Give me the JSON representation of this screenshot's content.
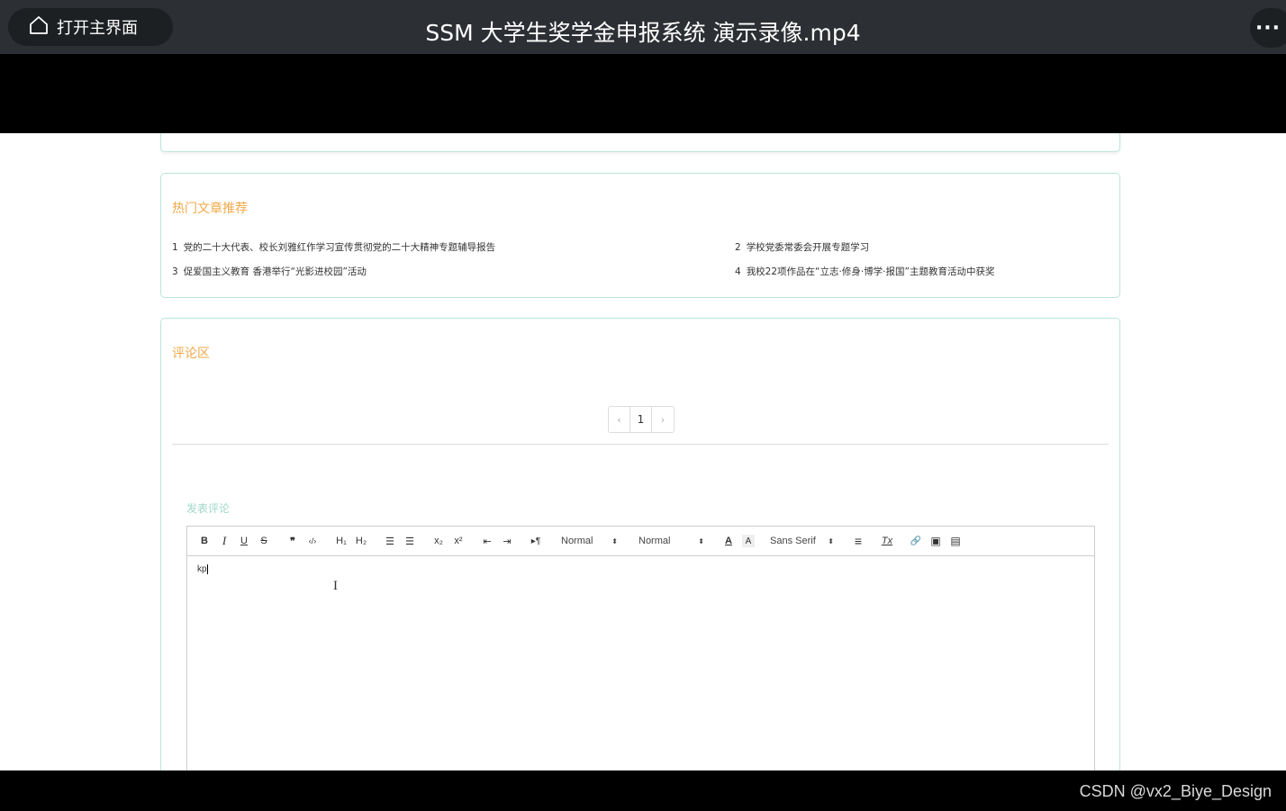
{
  "player": {
    "home_label": "打开主界面",
    "title": "SSM 大学生奖学金申报系统 演示录像.mp4",
    "more_label": "···"
  },
  "hot": {
    "title": "热门文章推荐",
    "articles": [
      {
        "num": "1",
        "text": "党的二十大代表、校长刘雅红作学习宣传贯彻党的二十大精神专题辅导报告"
      },
      {
        "num": "2",
        "text": "学校党委常委会开展专题学习"
      },
      {
        "num": "3",
        "text": "促爱国主义教育 香港举行“光影进校园”活动"
      },
      {
        "num": "4",
        "text": "我校22项作品在“立志·修身·博学·报国”主题教育活动中获奖"
      }
    ]
  },
  "comments": {
    "title": "评论区",
    "pager": {
      "prev": "‹",
      "current": "1",
      "next": "›"
    },
    "post_label": "发表评论"
  },
  "editor": {
    "bold": "B",
    "italic": "I",
    "underline": "U",
    "strike": "S",
    "blockquote": "❞",
    "code": "‹/›",
    "h1": "H₁",
    "h2": "H₂",
    "ordered": "☰",
    "bullet": "☰",
    "sub": "x₂",
    "sup": "x²",
    "outdent": "⇤",
    "indent": "⇥",
    "direction": "▸¶",
    "size_select": "Normal",
    "header_select": "Normal",
    "color": "A",
    "background": "A",
    "font_select": "Sans Serif",
    "align": "≡",
    "clean": "Tx",
    "link": "🔗",
    "image": "▣",
    "video": "▤",
    "content": "kp"
  },
  "watermark": "CSDN @vx2_Biye_Design"
}
